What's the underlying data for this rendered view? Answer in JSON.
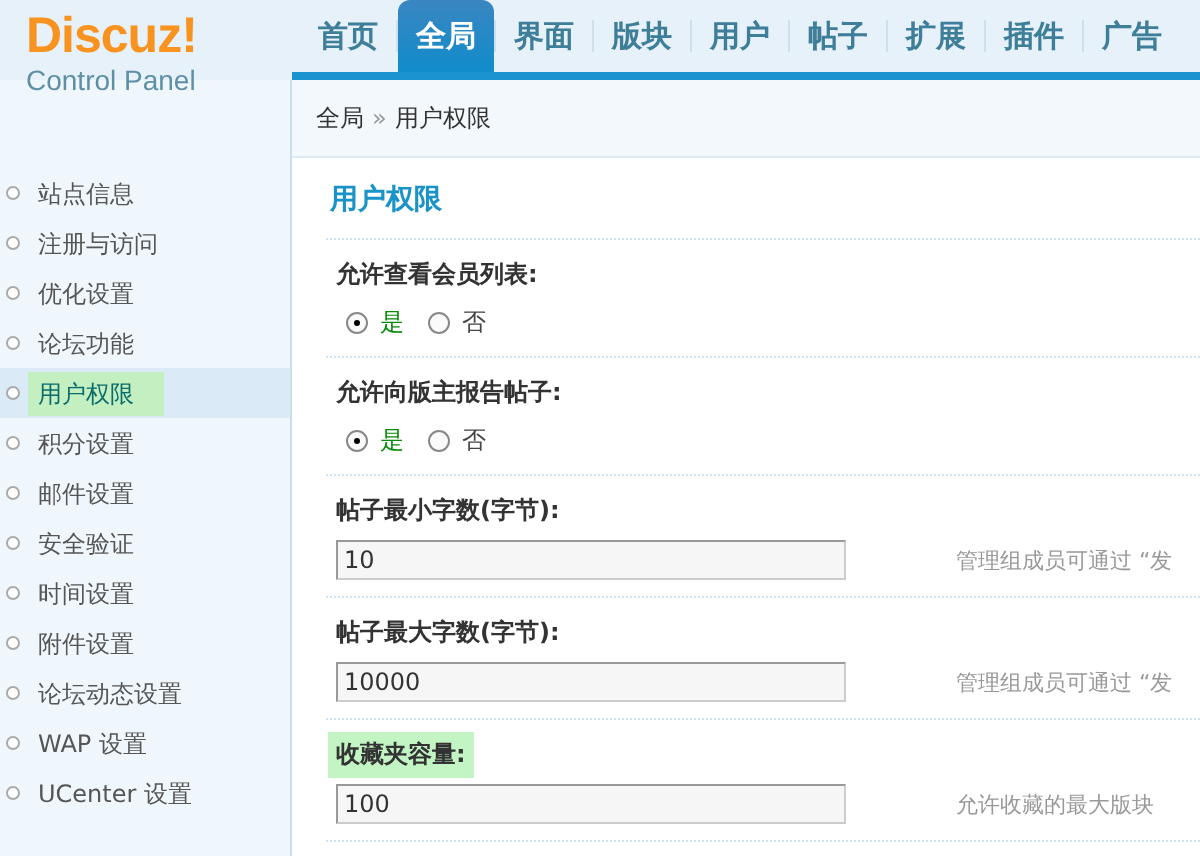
{
  "logo": {
    "brand": "Discuz!",
    "subtitle": "Control Panel"
  },
  "nav": [
    {
      "label": "首页",
      "selected": false
    },
    {
      "label": "全局",
      "selected": true
    },
    {
      "label": "界面",
      "selected": false
    },
    {
      "label": "版块",
      "selected": false
    },
    {
      "label": "用户",
      "selected": false
    },
    {
      "label": "帖子",
      "selected": false
    },
    {
      "label": "扩展",
      "selected": false
    },
    {
      "label": "插件",
      "selected": false
    },
    {
      "label": "广告",
      "selected": false
    }
  ],
  "breadcrumb": {
    "parent": "全局",
    "separator": "»",
    "current": "用户权限"
  },
  "sidebar": {
    "items": [
      {
        "label": "站点信息",
        "selected": false
      },
      {
        "label": "注册与访问",
        "selected": false
      },
      {
        "label": "优化设置",
        "selected": false
      },
      {
        "label": "论坛功能",
        "selected": false
      },
      {
        "label": "用户权限",
        "selected": true
      },
      {
        "label": "积分设置",
        "selected": false
      },
      {
        "label": "邮件设置",
        "selected": false
      },
      {
        "label": "安全验证",
        "selected": false
      },
      {
        "label": "时间设置",
        "selected": false
      },
      {
        "label": "附件设置",
        "selected": false
      },
      {
        "label": "论坛动态设置",
        "selected": false
      },
      {
        "label": "WAP 设置",
        "selected": false
      },
      {
        "label": "UCenter 设置",
        "selected": false
      }
    ]
  },
  "section_title": "用户权限",
  "settings": [
    {
      "kind": "radio",
      "label": "允许查看会员列表:",
      "highlighted": false,
      "options": [
        {
          "label": "是",
          "selected": true
        },
        {
          "label": "否",
          "selected": false
        }
      ]
    },
    {
      "kind": "radio",
      "label": "允许向版主报告帖子:",
      "highlighted": false,
      "options": [
        {
          "label": "是",
          "selected": true
        },
        {
          "label": "否",
          "selected": false
        }
      ]
    },
    {
      "kind": "text",
      "label": "帖子最小字数(字节):",
      "highlighted": false,
      "value": "10",
      "hint": "管理组成员可通过 “发"
    },
    {
      "kind": "text",
      "label": "帖子最大字数(字节):",
      "highlighted": false,
      "value": "10000",
      "hint": "管理组成员可通过 “发"
    },
    {
      "kind": "text",
      "label": "收藏夹容量:",
      "highlighted": true,
      "value": "100",
      "hint": "允许收藏的最大版块"
    }
  ]
}
